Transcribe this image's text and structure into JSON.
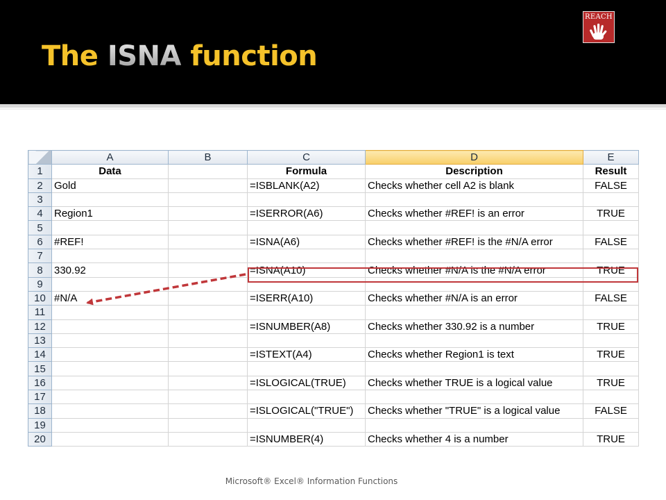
{
  "slide": {
    "title_prefix": "The ",
    "title_highlight": "ISNA",
    "title_suffix": " function",
    "logo_text": "REACH",
    "footer": "Microsoft® Excel® Information Functions"
  },
  "sheet": {
    "columns": [
      "A",
      "B",
      "C",
      "D",
      "E"
    ],
    "selected_column": "D",
    "rows": [
      {
        "n": "1",
        "a": "Data",
        "c": "Formula",
        "d": "Description",
        "e": "Result"
      },
      {
        "n": "2",
        "a": "Gold",
        "c": "=ISBLANK(A2)",
        "d": "Checks whether cell A2 is blank",
        "e": "FALSE"
      },
      {
        "n": "3",
        "a": "",
        "c": "",
        "d": "",
        "e": ""
      },
      {
        "n": "4",
        "a": "Region1",
        "c": "=ISERROR(A6)",
        "d": "Checks whether #REF! is an error",
        "e": "TRUE"
      },
      {
        "n": "5",
        "a": "",
        "c": "",
        "d": "",
        "e": ""
      },
      {
        "n": "6",
        "a": "#REF!",
        "c": "=ISNA(A6)",
        "d": "Checks whether #REF! is the #N/A error",
        "e": "FALSE"
      },
      {
        "n": "7",
        "a": "",
        "c": "",
        "d": "",
        "e": ""
      },
      {
        "n": "8",
        "a": "330.92",
        "c": "=ISNA(A10)",
        "d": "Checks whether #N/A is the #N/A error",
        "e": "TRUE"
      },
      {
        "n": "9",
        "a": "",
        "c": "",
        "d": "",
        "e": ""
      },
      {
        "n": "10",
        "a": "#N/A",
        "c": "=ISERR(A10)",
        "d": "Checks whether #N/A is an error",
        "e": "FALSE"
      },
      {
        "n": "11",
        "a": "",
        "c": "",
        "d": "",
        "e": ""
      },
      {
        "n": "12",
        "a": "",
        "c": "=ISNUMBER(A8)",
        "d": "Checks whether 330.92 is a number",
        "e": "TRUE"
      },
      {
        "n": "13",
        "a": "",
        "c": "",
        "d": "",
        "e": ""
      },
      {
        "n": "14",
        "a": "",
        "c": "=ISTEXT(A4)",
        "d": "Checks whether Region1 is text",
        "e": "TRUE"
      },
      {
        "n": "15",
        "a": "",
        "c": "",
        "d": "",
        "e": ""
      },
      {
        "n": "16",
        "a": "",
        "c": "=ISLOGICAL(TRUE)",
        "d": "Checks whether TRUE is a logical value",
        "e": "TRUE"
      },
      {
        "n": "17",
        "a": "",
        "c": "",
        "d": "",
        "e": ""
      },
      {
        "n": "18",
        "a": "",
        "c": "=ISLOGICAL(\"TRUE\")",
        "d": "Checks whether \"TRUE\" is a logical value",
        "e": "FALSE"
      },
      {
        "n": "19",
        "a": "",
        "c": "",
        "d": "",
        "e": ""
      },
      {
        "n": "20",
        "a": "",
        "c": "=ISNUMBER(4)",
        "d": "Checks whether 4 is a number",
        "e": "TRUE"
      }
    ],
    "highlighted_row": "8",
    "arrow_target_row": "10"
  },
  "colors": {
    "title": "#f5c22a",
    "title_highlight": "#c0c0c0",
    "logo_bg": "#b72a2a",
    "highlight": "#c0373a"
  },
  "icons": {
    "logo": "reach-hand-icon",
    "corner": "select-all-icon"
  }
}
